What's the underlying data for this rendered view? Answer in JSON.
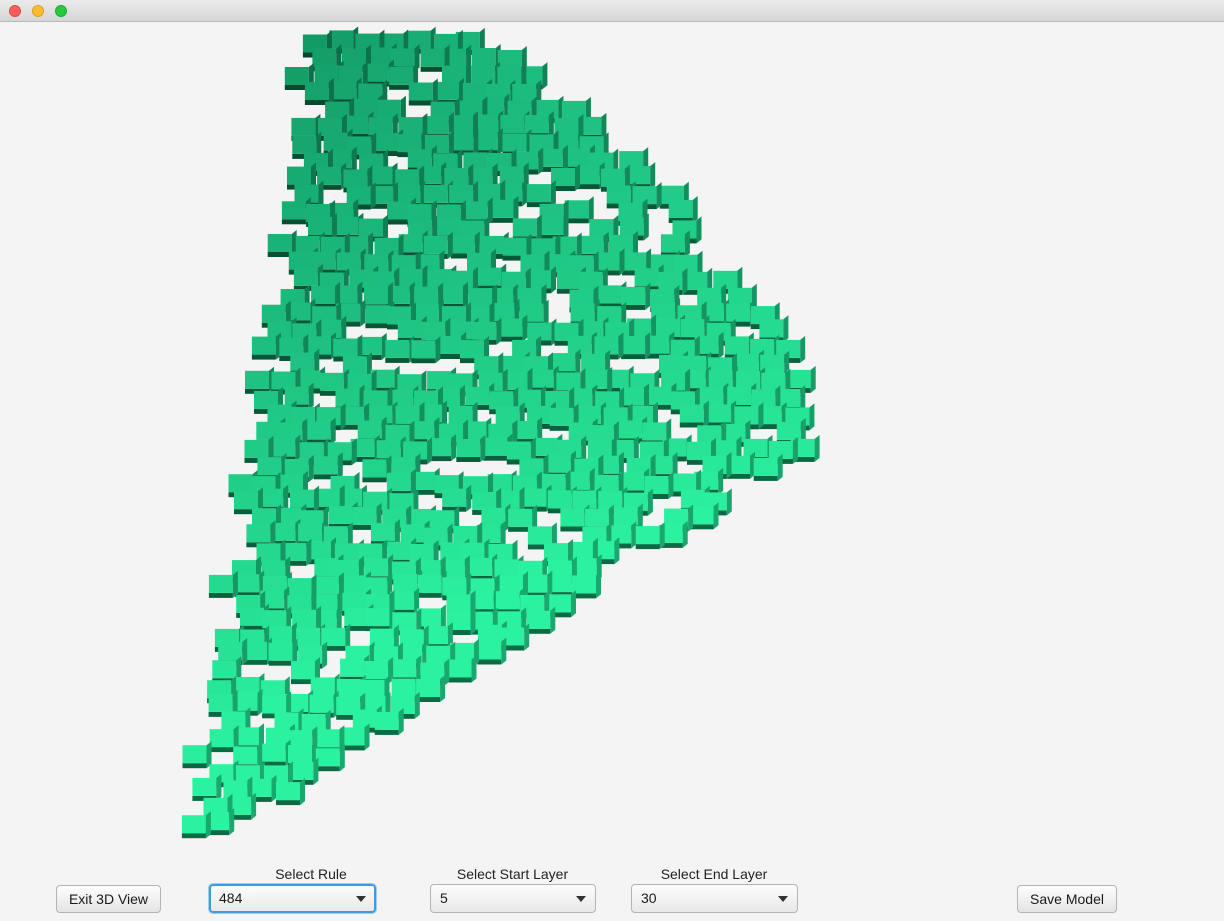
{
  "window": {
    "traffic_lights": [
      "close",
      "minimize",
      "zoom"
    ]
  },
  "viewport": {
    "content": "3D voxel model",
    "colors": {
      "cube_top_light": "#2bf2a0",
      "cube_top_dark": "#0e8a5b",
      "cube_side": "#0a6b45",
      "cube_shadow": "#063f28"
    }
  },
  "controls": {
    "exit_button": "Exit 3D View",
    "rule": {
      "label": "Select Rule",
      "value": "484"
    },
    "start_layer": {
      "label": "Select Start Layer",
      "value": "5"
    },
    "end_layer": {
      "label": "Select End Layer",
      "value": "30"
    },
    "save_button": "Save Model"
  }
}
